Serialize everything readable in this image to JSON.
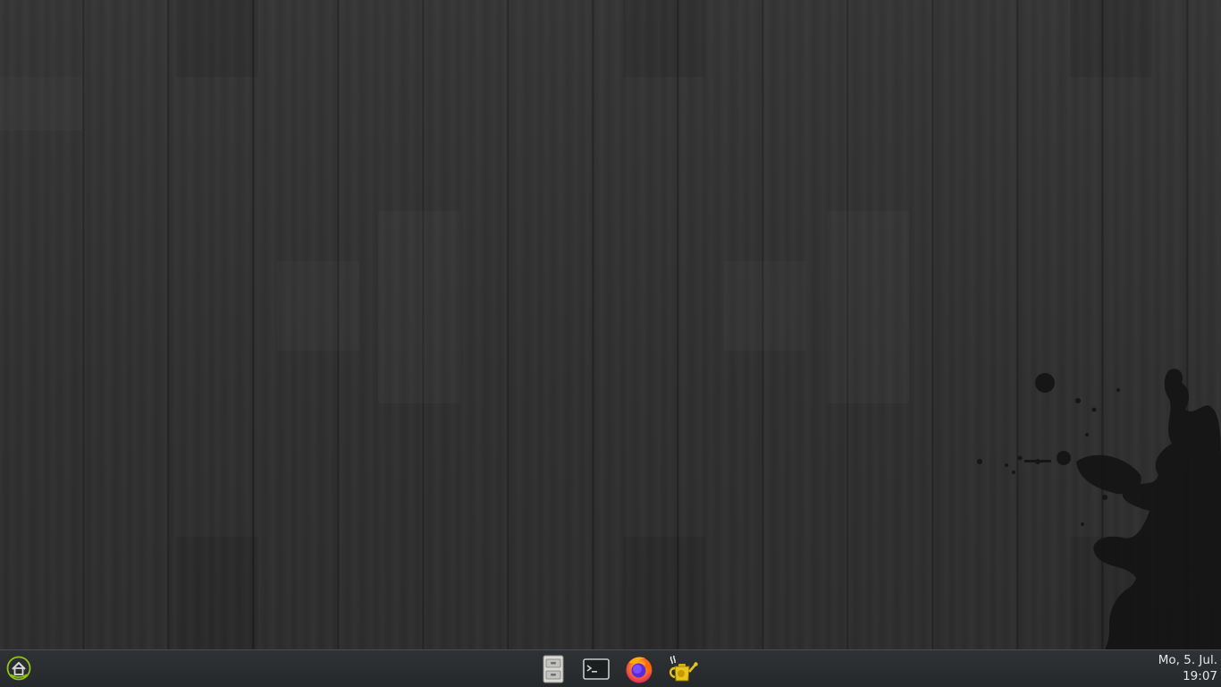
{
  "desktop": {
    "wallpaper": "dark-wood-planks-with-ink-splatter",
    "colors": {
      "wood_base": "#333333",
      "panel_bg": "#26292b",
      "clock_text": "#e6e6e6",
      "launcher_accent": "#8fc31f"
    }
  },
  "panel": {
    "launcher": {
      "icon": "application-launcher-icon"
    },
    "taskbar": [
      {
        "icon": "file-manager-icon"
      },
      {
        "icon": "terminal-icon"
      },
      {
        "icon": "firefox-icon"
      },
      {
        "icon": "watering-can-icon"
      }
    ],
    "clock": {
      "date": "Mo, 5. Jul.",
      "time": "19:07"
    }
  }
}
